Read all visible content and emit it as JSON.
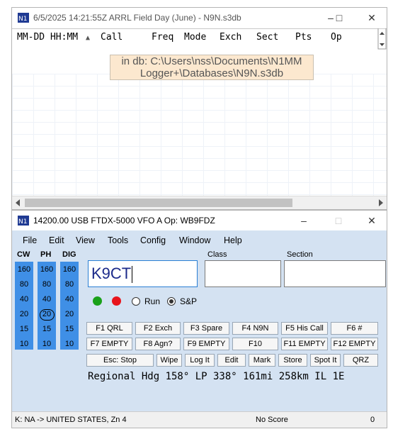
{
  "log_window": {
    "title": "6/5/2025 14:21:55Z  ARRL Field Day (June) - N9N.s3db",
    "columns": [
      "MM-DD HH:MM",
      "▲",
      "Call",
      "Freq",
      "Mode",
      "Exch",
      "Sect",
      "Pts",
      "Op"
    ],
    "tooltip_line1": "in db: C:\\Users\\nss\\Documents\\N1MM",
    "tooltip_line2": "Logger+\\Databases\\N9N.s3db"
  },
  "entry_window": {
    "title": "14200.00 USB FTDX-5000 VFO A    Op: WB9FDZ",
    "menu": [
      "File",
      "Edit",
      "View",
      "Tools",
      "Config",
      "Window",
      "Help"
    ],
    "band_headers": [
      "CW",
      "PH",
      "DIG"
    ],
    "bands": [
      "160",
      "80",
      "40",
      "20",
      "15",
      "10"
    ],
    "call_value": "K9CT",
    "class_label": "Class",
    "section_label": "Section",
    "run_label": "Run",
    "sp_label": "S&P",
    "fkeys_row1": [
      "F1 QRL",
      "F2 Exch",
      "F3 Spare",
      "F4 N9N",
      "F5 His Call",
      "F6 #"
    ],
    "fkeys_row2": [
      "F7 EMPTY",
      "F8 Agn?",
      "F9 EMPTY",
      "F10",
      "F11 EMPTY",
      "F12 EMPTY"
    ],
    "buttons_row3": [
      "Esc: Stop",
      "Wipe",
      "Log It",
      "Edit",
      "Mark",
      "Store",
      "Spot It",
      "QRZ"
    ],
    "info_line": "Regional Hdg 158° LP 338° 161mi 258km IL 1E",
    "status_left": "K: NA -> UNITED STATES, Zn 4",
    "status_mid": "No Score",
    "status_right": "0"
  },
  "colors": {
    "band_blue": "#3f8fe6",
    "entry_bg": "#d4e2f2",
    "tooltip_bg": "#fce8cf",
    "green_dot": "#1aa11a",
    "red_dot": "#e8141c"
  }
}
